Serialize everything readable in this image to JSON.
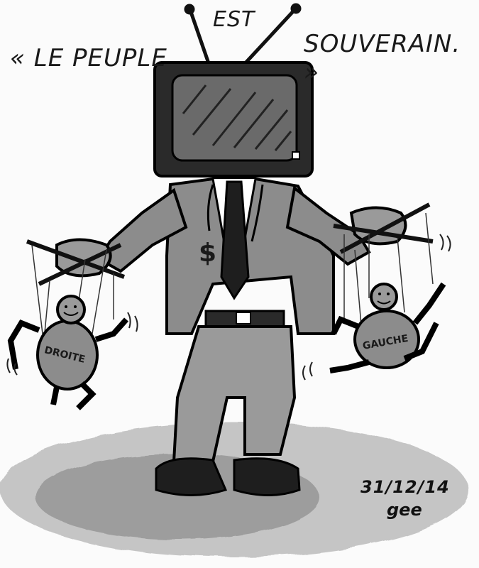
{
  "caption": {
    "left": "« LE PEUPLE",
    "middle": "EST",
    "right": "SOUVERAIN. »"
  },
  "puppets": {
    "left_label": "DROITE",
    "right_label": "GAUCHE"
  },
  "tie_symbol": "$",
  "signature": {
    "date": "31/12/14",
    "author": "gee"
  }
}
